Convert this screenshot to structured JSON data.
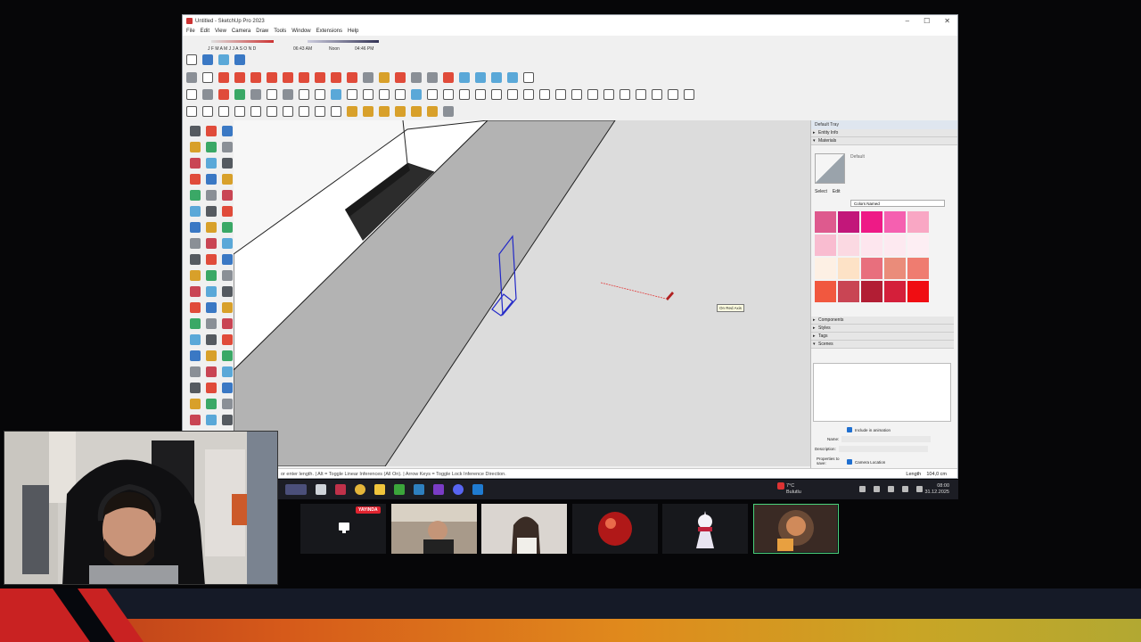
{
  "window": {
    "title": "Untitled - SketchUp Pro 2023",
    "controls": [
      "–",
      "☐",
      "✕"
    ]
  },
  "menu": [
    "File",
    "Edit",
    "View",
    "Camera",
    "Draw",
    "Tools",
    "Window",
    "Extensions",
    "Help"
  ],
  "shadow": {
    "months": "J F M A M J J A S O N D",
    "start_time": "06:43 AM",
    "noon": "Noon",
    "end_time": "04:46 PM"
  },
  "tooltip": "On Red Axis",
  "tray": {
    "title": "Default Tray",
    "entity_info": "Entity Info",
    "materials": "Materials",
    "material_name": "Default",
    "select_tab": "Select",
    "edit_tab": "Edit",
    "collection": "Colors Named",
    "swatches": [
      "#de5a8e",
      "#c2177a",
      "#ee1a86",
      "#f560b0",
      "#f9a7c4",
      "#f9bcd0",
      "#fbd9e2",
      "#fde6ee",
      "#fde9f0",
      "#fdeef3",
      "#fdf0e4",
      "#fde2c6",
      "#e86f7d",
      "#ea8c7a",
      "#ef7c70",
      "#f1583f",
      "#c94554",
      "#b21e34",
      "#d41f3a",
      "#f00d12"
    ],
    "sections": [
      "Components",
      "Styles",
      "Tags",
      "Scenes"
    ],
    "include_animation": "Include in animation",
    "name_label": "Name:",
    "description_label": "Description:",
    "properties_label": "Properties to save:",
    "camera_location": "Camera Location",
    "hidden_geometry": "Top-Level Hidden Geometry"
  },
  "status": {
    "hint": "or enter length. | Alt = Toggle Linear Inferences (All On). | Arrow Keys = Toggle Lock Inference Direction.",
    "length_label": "Length",
    "length_value": "104,0 cm"
  },
  "taskbar": {
    "weather_temp": "7°C",
    "weather_text": "Bulutlu",
    "time": "08:00",
    "date": "31.12.2025"
  },
  "call": {
    "live_badge": "YAYINDA"
  }
}
